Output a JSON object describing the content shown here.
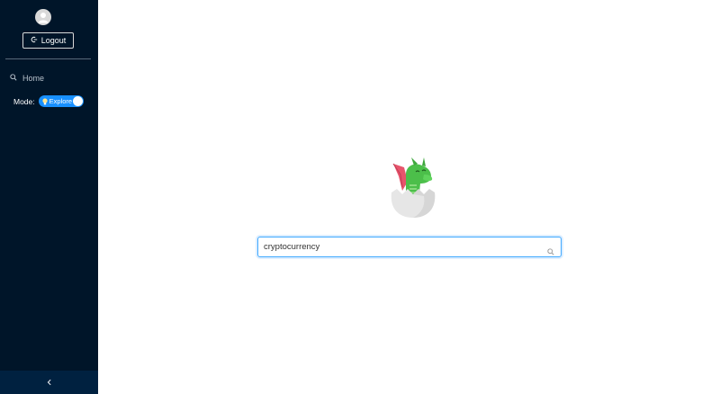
{
  "sidebar": {
    "avatar_icon": "user-icon",
    "logout_label": "Logout",
    "logout_icon": "logout-icon",
    "nav": [
      {
        "label": "Home",
        "icon": "search-icon"
      }
    ],
    "mode": {
      "label": "Mode:",
      "toggle_label": "Explore",
      "toggle_icon": "lightbulb-icon",
      "enabled": true
    },
    "collapse_icon": "chevron-left-icon"
  },
  "main": {
    "mascot": "dragon-egg-logo",
    "search": {
      "value": "cryptocurrency",
      "icon": "search-icon"
    }
  },
  "colors": {
    "sidebar_bg": "#001529",
    "collapse_bg": "#002140",
    "accent": "#1890ff",
    "search_border": "#40a9ff"
  }
}
